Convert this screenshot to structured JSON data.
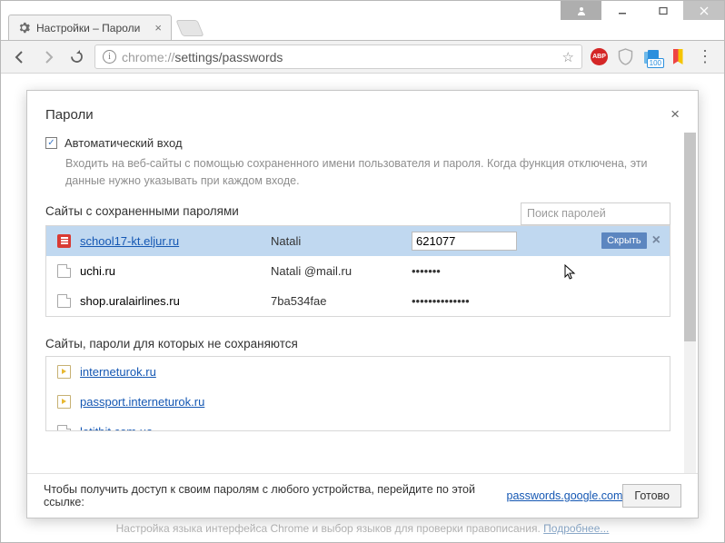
{
  "tab": {
    "title": "Настройки – Пароли"
  },
  "omnibox": {
    "scheme": "chrome://",
    "path": "settings/passwords"
  },
  "ext": {
    "abp": "ABP",
    "files_badge": "100"
  },
  "dialog": {
    "title": "Пароли",
    "autocheck_label": "Автоматический вход",
    "autocheck_desc": "Входить на веб-сайты с помощью сохраненного имени пользователя и пароля. Когда функция отключена, эти данные нужно указывать при каждом входе.",
    "saved_heading": "Сайты с сохраненными паролями",
    "search_placeholder": "Поиск паролей",
    "hide_label": "Скрыть",
    "never_heading": "Сайты, пароли для которых не сохраняются",
    "footer_text": "Чтобы получить доступ к своим паролям с любого устройства, перейдите по этой ссылке: ",
    "footer_link": "passwords.google.com",
    "done": "Готово"
  },
  "saved": [
    {
      "site": "school17-kt.eljur.ru",
      "user": "Natali",
      "pass": "621077",
      "revealed": true,
      "selected": true,
      "icon": "doc"
    },
    {
      "site": "uchi.ru",
      "user": "Natali @mail.ru",
      "pass": "•••••••",
      "revealed": false,
      "selected": false,
      "icon": "file"
    },
    {
      "site": "shop.uralairlines.ru",
      "user": "7ba534fae",
      "pass": "••••••••••••••",
      "revealed": false,
      "selected": false,
      "icon": "file"
    }
  ],
  "never": [
    {
      "site": "interneturok.ru",
      "icon": "play"
    },
    {
      "site": "passport.interneturok.ru",
      "icon": "play"
    },
    {
      "site": "letitbit.com.ua",
      "icon": "file"
    }
  ],
  "bg": {
    "text": "Настройка языка интерфейса Chrome и выбор языков для проверки правописания. ",
    "link": "Подробнее..."
  }
}
